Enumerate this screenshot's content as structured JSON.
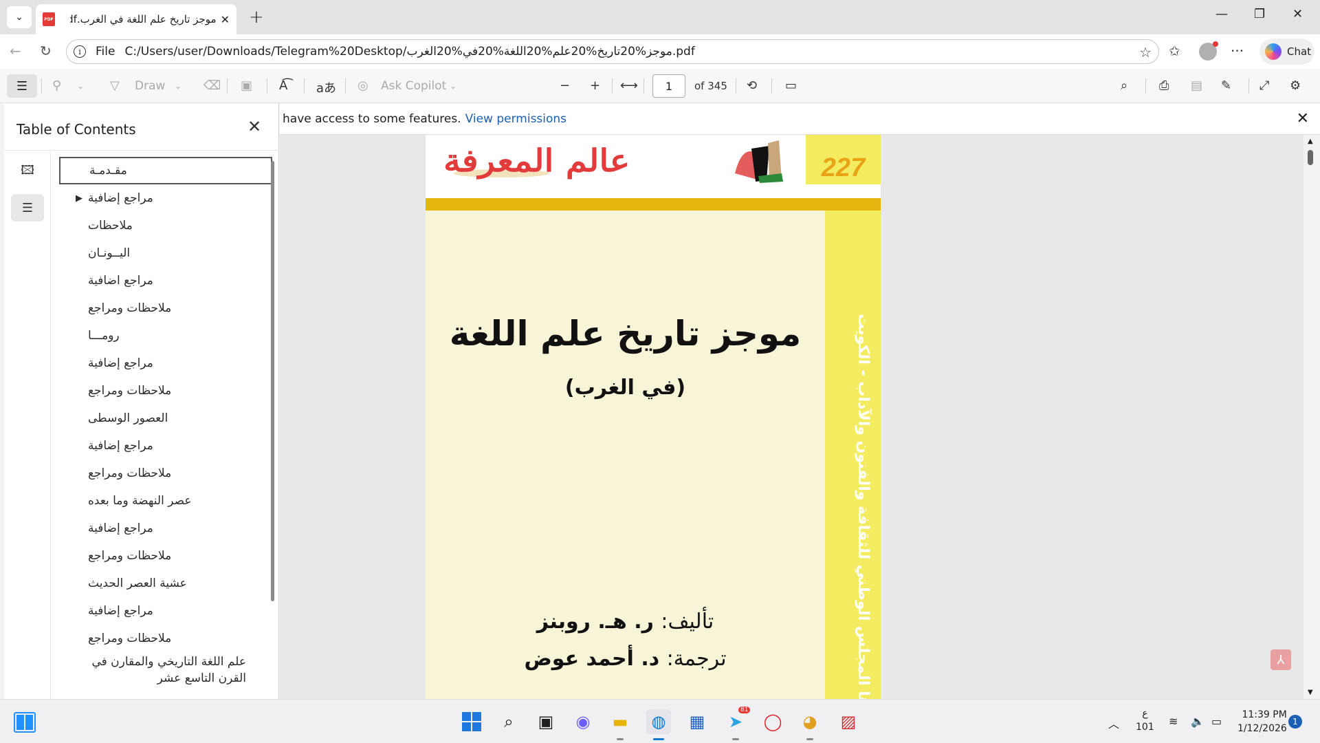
{
  "browser": {
    "tab_title": "موجز تاريخ علم اللغة في الغرب.pdf",
    "url_scheme": "File",
    "url": "C:/Users/user/Downloads/Telegram%20Desktop/موجز%20تاريخ%20علم%20اللغة%20في%20الغرب.pdf",
    "chat_label": "Chat"
  },
  "pdf_toolbar": {
    "draw_label": "Draw",
    "copilot_label": "Ask Copilot",
    "page_current": "1",
    "page_total_label": "of 345"
  },
  "sidebar": {
    "title": "Table of Contents",
    "items": [
      {
        "label": "مقـدمـة"
      },
      {
        "label": "مراجع إضافية"
      },
      {
        "label": "ملاحظات"
      },
      {
        "label": "اليــونـان"
      },
      {
        "label": "مراجع اضافية"
      },
      {
        "label": "ملاحظات ومراجع"
      },
      {
        "label": "رومـــا"
      },
      {
        "label": "مراجع إضافية"
      },
      {
        "label": "ملاحظات ومراجع"
      },
      {
        "label": "العصور الوسطى"
      },
      {
        "label": "مراجع إضافية"
      },
      {
        "label": "ملاحظات ومراجع"
      },
      {
        "label": "عصر النهضة وما بعده"
      },
      {
        "label": "مراجع إضافية"
      },
      {
        "label": "ملاحظات ومراجع"
      },
      {
        "label": "عشية العصر الحديث"
      },
      {
        "label": "مراجع إضافية"
      },
      {
        "label": "ملاحظات ومراجع"
      },
      {
        "label": "علم اللغة التاريخي والمقارن في القرن التاسع عشر"
      }
    ]
  },
  "notice": {
    "text": "have access to some features.",
    "link": "View permissions"
  },
  "page": {
    "series_number": "227",
    "series_logo": "عالم المعرفة",
    "title": "موجز تاريخ علم اللغة",
    "subtitle": "(في الغرب)",
    "author_label": "تأليف:",
    "author": "ر. هـ. روبنز",
    "translator_label": "ترجمة:",
    "translator": "د. أحمد عوض",
    "side_text": "سلسلة كتب ثقافية شهرية يصدرها المجلس الوطني للثقافة والفنون والآداب - الكويت"
  },
  "taskbar": {
    "telegram_badge": "81",
    "lang_top": "ع",
    "lang_bottom": "101",
    "time": "11:39 PM",
    "date": "1/12/2026",
    "notifications": "1"
  }
}
